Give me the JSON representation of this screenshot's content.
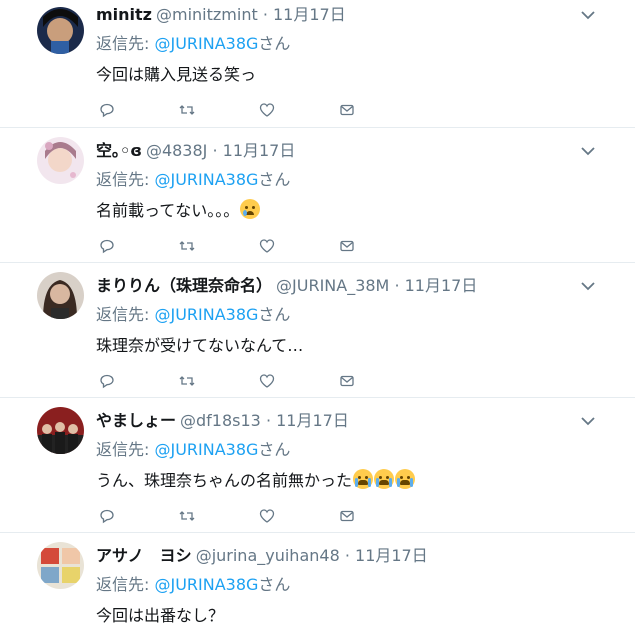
{
  "tweets": [
    {
      "name": "minitz",
      "handle": "@minitzmint",
      "date": "11月17日",
      "reply_prefix": "返信先: ",
      "reply_to": "@JURINA38G",
      "reply_suffix": "さん",
      "text": "今回は購入見送る笑っ",
      "avatar_colors": [
        "#1b2a4a",
        "#c99e7c"
      ]
    },
    {
      "name": "空｡◦ɞ",
      "handle": "@4838J",
      "date": "11月17日",
      "reply_prefix": "返信先: ",
      "reply_to": "@JURINA38G",
      "reply_suffix": "さん",
      "text": "名前載ってない。。。",
      "emoji": "crying-face",
      "avatar_colors": [
        "#f2e6ee",
        "#a97b8d"
      ]
    },
    {
      "name": "まりりん（珠理奈命名）",
      "handle": "@JURINA_38M",
      "date": "11月17日",
      "reply_prefix": "返信先: ",
      "reply_to": "@JURINA38G",
      "reply_suffix": "さん",
      "text": "珠理奈が受けてないなんて…",
      "avatar_colors": [
        "#3a2a22",
        "#d8b7a0"
      ]
    },
    {
      "name": "やましょー",
      "handle": "@df18s13",
      "date": "11月17日",
      "reply_prefix": "返信先: ",
      "reply_to": "@JURINA38G",
      "reply_suffix": "さん",
      "text": "うん、珠理奈ちゃんの名前無かった",
      "emoji_count": 3,
      "avatar_colors": [
        "#8a1f1f",
        "#222222"
      ]
    },
    {
      "name": "アサノ　ヨシ",
      "handle": "@jurina_yuihan48",
      "date": "11月17日",
      "reply_prefix": "返信先: ",
      "reply_to": "@JURINA38G",
      "reply_suffix": "さん",
      "text": "今回は出番なし？",
      "avatar_colors": [
        "#e9e3d6",
        "#d44a3a"
      ]
    }
  ],
  "separator": " · ",
  "colors": {
    "link": "#1da1f2",
    "meta": "#657786",
    "text": "#14171a",
    "icon": "#657786",
    "divider": "#e6ecf0"
  },
  "icons": [
    "reply-icon",
    "retweet-icon",
    "like-icon",
    "dm-icon",
    "chevron-down-icon"
  ]
}
